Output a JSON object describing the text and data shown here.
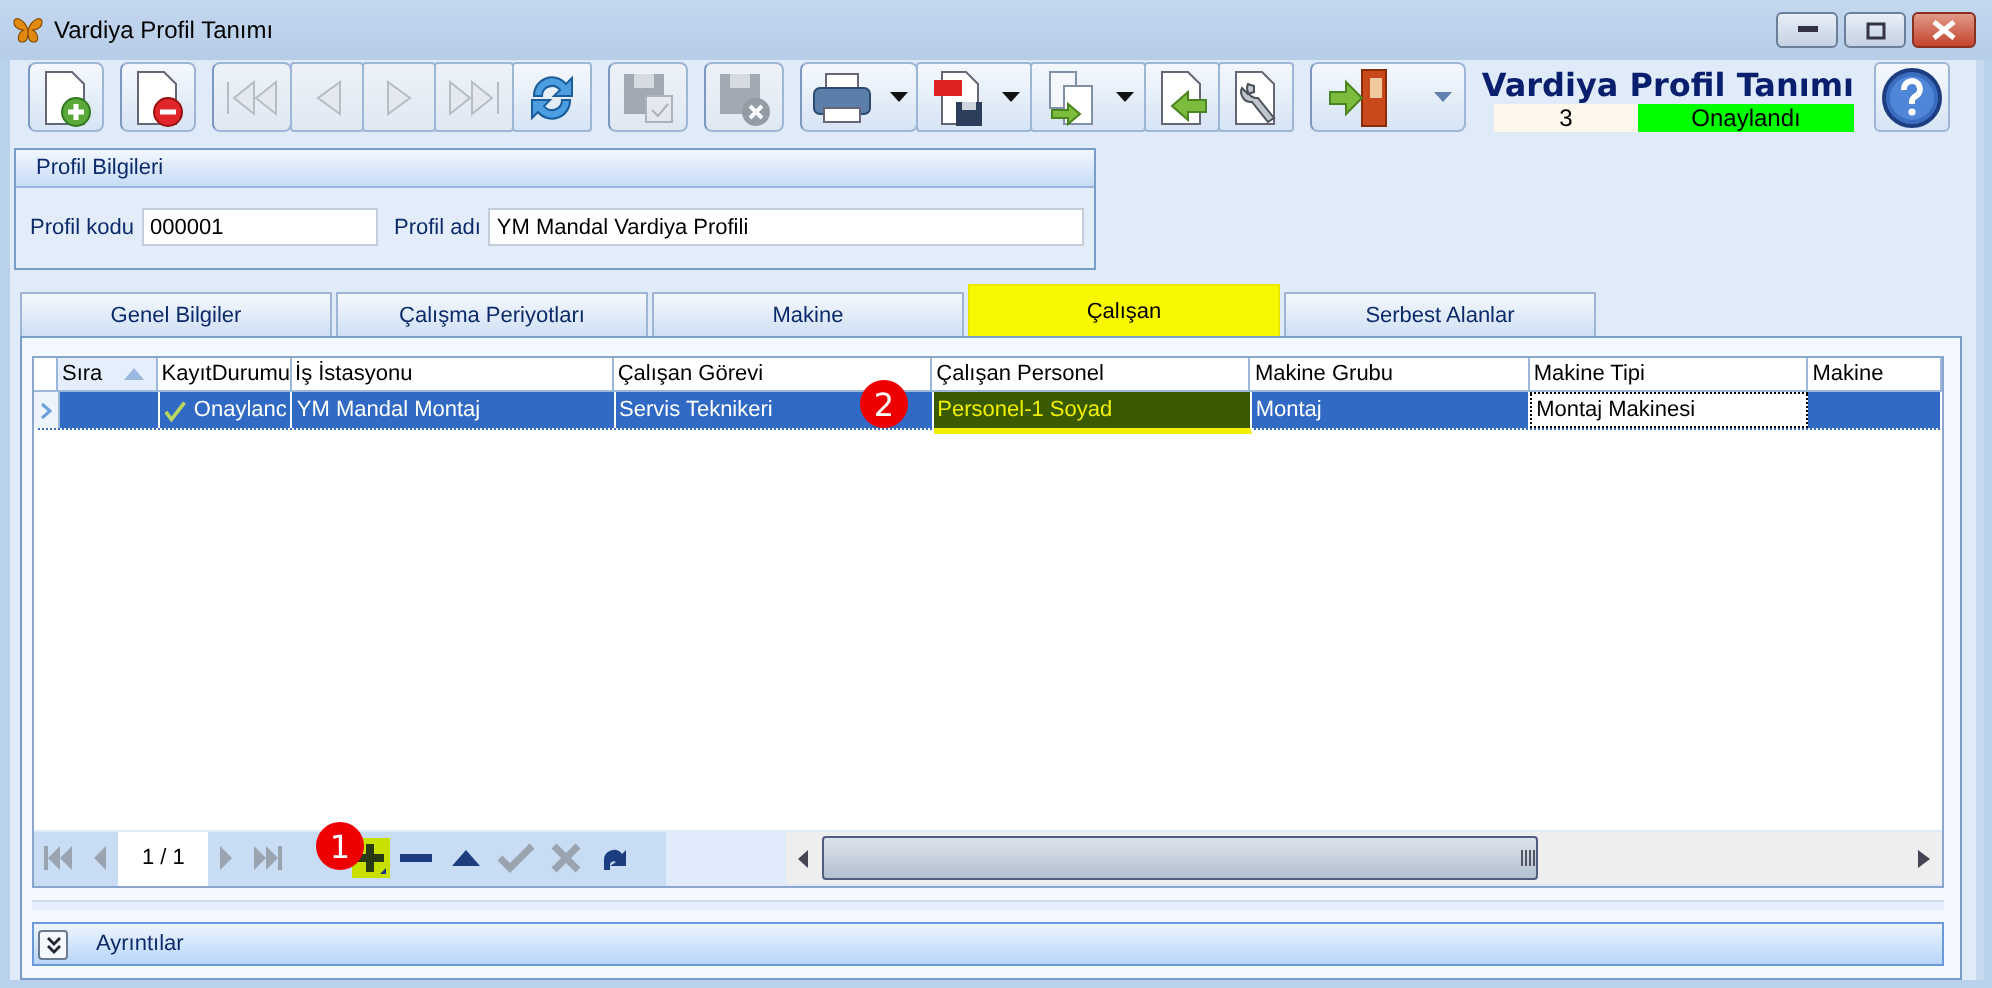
{
  "window": {
    "title": "Vardiya Profil Tanımı"
  },
  "toolbar": [
    {
      "kind": "new",
      "disabled": false,
      "dropdown": false,
      "group_start": true
    },
    {
      "kind": "delete",
      "disabled": false,
      "dropdown": false,
      "group_start": true
    },
    {
      "kind": "first",
      "disabled": true,
      "dropdown": false,
      "group_start": true
    },
    {
      "kind": "prev",
      "disabled": true,
      "dropdown": false,
      "group_start": false
    },
    {
      "kind": "next",
      "disabled": true,
      "dropdown": false,
      "group_start": false
    },
    {
      "kind": "last",
      "disabled": true,
      "dropdown": false,
      "group_start": false
    },
    {
      "kind": "refresh",
      "disabled": false,
      "dropdown": false,
      "group_start": false
    },
    {
      "kind": "save",
      "disabled": true,
      "dropdown": false,
      "group_start": true
    },
    {
      "kind": "save-cancel",
      "disabled": true,
      "dropdown": false,
      "group_start": true
    },
    {
      "kind": "print",
      "disabled": false,
      "dropdown": true,
      "group_start": true
    },
    {
      "kind": "pdf",
      "disabled": false,
      "dropdown": true,
      "group_start": false
    },
    {
      "kind": "copy",
      "disabled": false,
      "dropdown": true,
      "group_start": false
    },
    {
      "kind": "import",
      "disabled": false,
      "dropdown": false,
      "group_start": false
    },
    {
      "kind": "settings",
      "disabled": false,
      "dropdown": false,
      "group_start": false
    },
    {
      "kind": "exit",
      "disabled": false,
      "dropdown": true,
      "group_start": true
    }
  ],
  "header": {
    "title": "Vardiya Profil Tanımı",
    "record": "3",
    "status": "Onaylandı"
  },
  "profile": {
    "title": "Profil Bilgileri",
    "fields": [
      {
        "label": "Profil kodu",
        "value": "000001"
      },
      {
        "label": "Profil adı",
        "value": "YM Mandal Vardiya Profili"
      }
    ]
  },
  "tabs": [
    {
      "label": "Genel Bilgiler",
      "selected": false
    },
    {
      "label": "Çalışma Periyotları",
      "selected": false
    },
    {
      "label": "Makine",
      "selected": false
    },
    {
      "label": "Çalışan",
      "selected": true
    },
    {
      "label": "Serbest Alanlar",
      "selected": false
    }
  ],
  "grid": {
    "columns": [
      {
        "label": "Sıra",
        "sorted": true
      },
      {
        "label": "KayıtDurumu",
        "sorted": false
      },
      {
        "label": "İş İstasyonu",
        "sorted": false
      },
      {
        "label": "Çalışan Görevi",
        "sorted": false
      },
      {
        "label": "Çalışan Personel",
        "sorted": false
      },
      {
        "label": "Makine Grubu",
        "sorted": false
      },
      {
        "label": "Makine Tipi",
        "sorted": false
      },
      {
        "label": "Makine",
        "sorted": false
      }
    ],
    "rows": [
      {
        "selected": true,
        "cells": [
          {
            "text": "",
            "kind": "text",
            "focused": false,
            "highlighted": false
          },
          {
            "text": "Onaylanc",
            "kind": "status",
            "focused": false,
            "highlighted": false
          },
          {
            "text": "YM Mandal Montaj",
            "kind": "text",
            "focused": false,
            "highlighted": false
          },
          {
            "text": "Servis Teknikeri",
            "kind": "text",
            "focused": false,
            "highlighted": false
          },
          {
            "text": "Personel-1 Soyad",
            "kind": "text",
            "focused": false,
            "highlighted": true
          },
          {
            "text": "Montaj",
            "kind": "text",
            "focused": false,
            "highlighted": false
          },
          {
            "text": "Montaj Makinesi",
            "kind": "text",
            "focused": true,
            "highlighted": false
          },
          {
            "text": "",
            "kind": "text",
            "focused": false,
            "highlighted": false
          }
        ]
      }
    ]
  },
  "navigator": {
    "page": "1 / 1",
    "buttons": [
      {
        "kind": "first",
        "disabled": true,
        "highlighted": false
      },
      {
        "kind": "prev",
        "disabled": true,
        "highlighted": false
      },
      {
        "kind": "page"
      },
      {
        "kind": "next",
        "disabled": true,
        "highlighted": false
      },
      {
        "kind": "last",
        "disabled": true,
        "highlighted": false
      },
      {
        "kind": "append",
        "disabled": false,
        "highlighted": true
      },
      {
        "kind": "remove",
        "disabled": false,
        "highlighted": false
      },
      {
        "kind": "up",
        "disabled": false,
        "highlighted": false
      },
      {
        "kind": "ok",
        "disabled": true,
        "highlighted": false
      },
      {
        "kind": "cancel",
        "disabled": true,
        "highlighted": false
      },
      {
        "kind": "redo",
        "disabled": false,
        "highlighted": false
      }
    ]
  },
  "callouts": [
    {
      "text": "1"
    },
    {
      "text": "2"
    }
  ],
  "details": {
    "title": "Ayrıntılar",
    "expanded": false
  }
}
